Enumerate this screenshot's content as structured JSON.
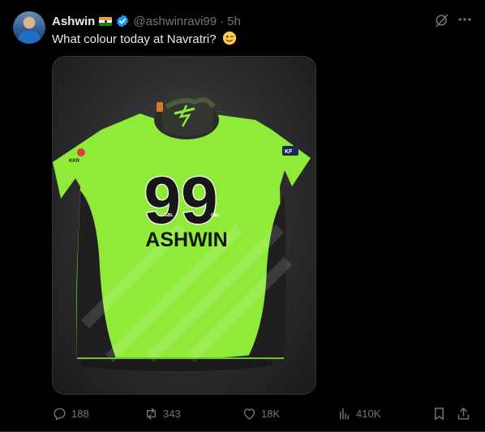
{
  "author": {
    "name": "Ashwin",
    "handle": "@ashwinravi99",
    "separator": "·",
    "time": "5h",
    "flag_icon": "india-flag-icon",
    "verified_icon": "verified-badge-icon",
    "verified_color": "#1d9bf0"
  },
  "tweet": {
    "text": "What colour today at Navratri?",
    "emoji_icon": "winking-face-emoji"
  },
  "media": {
    "jersey_number": "99",
    "jersey_name": "ASHWIN",
    "jersey_color": "#8fea3a"
  },
  "actions": {
    "replies": "188",
    "retweets": "343",
    "likes": "18K",
    "views": "410K"
  },
  "colors": {
    "background": "#000000",
    "text_primary": "#e7e9ea",
    "text_secondary": "#71767b",
    "border": "#2f3336"
  }
}
